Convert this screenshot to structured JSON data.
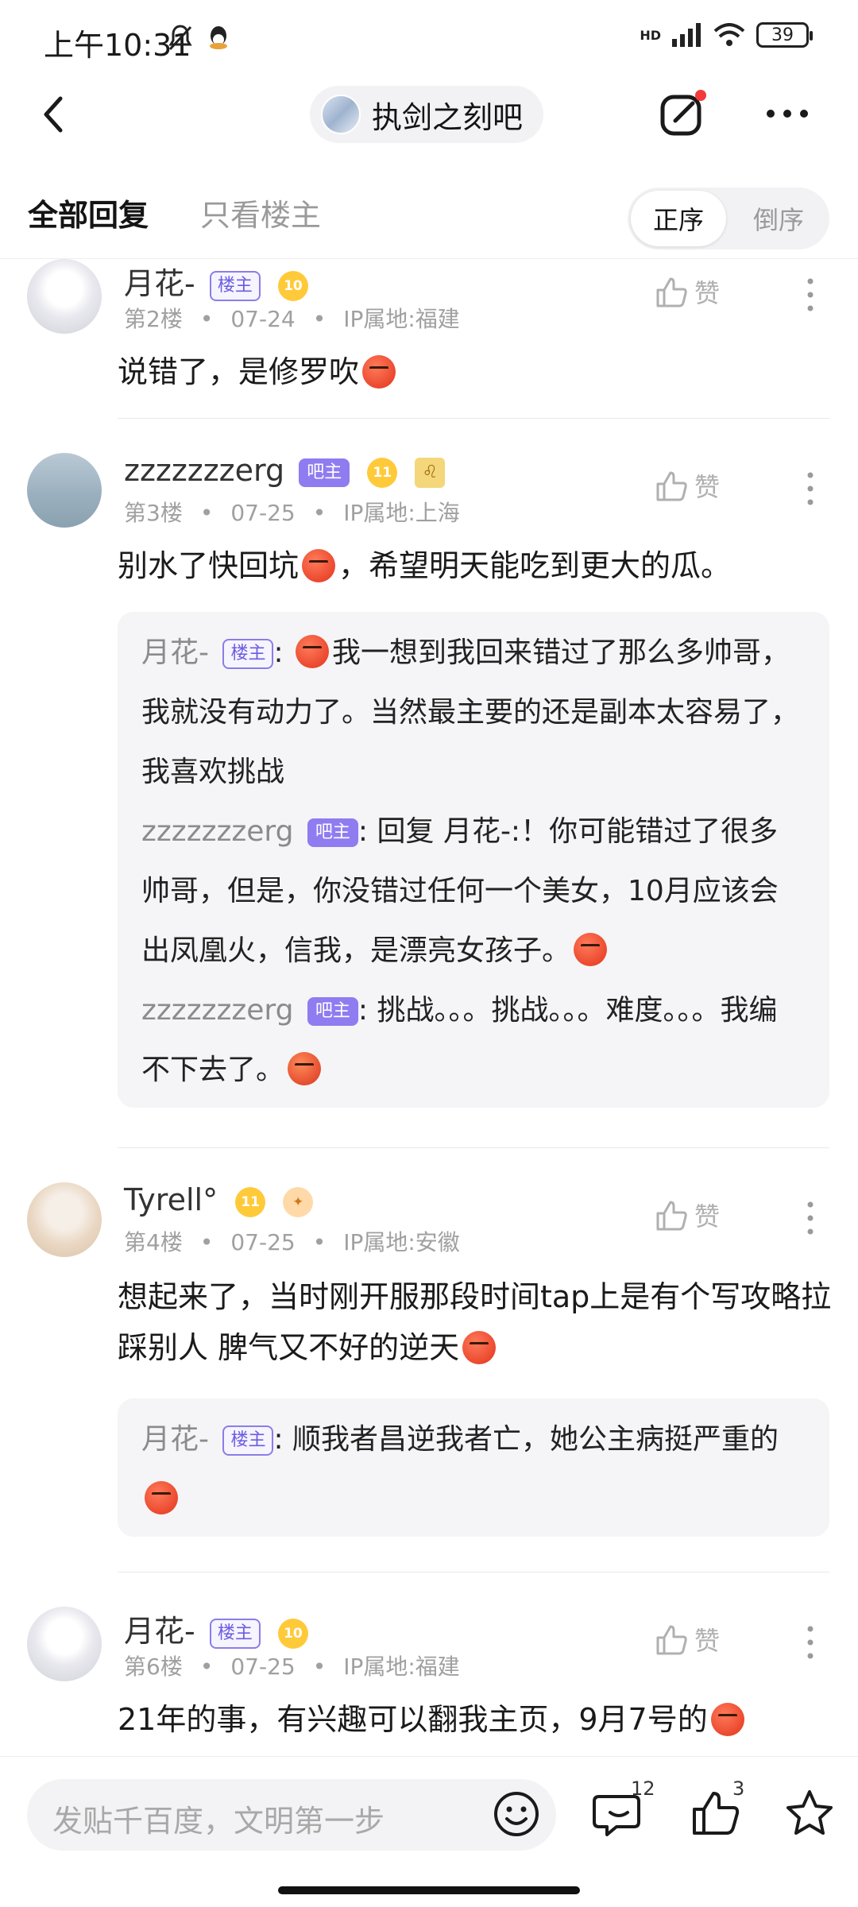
{
  "status_bar": {
    "time": "上午10:31",
    "network": "HD",
    "battery": "39"
  },
  "header": {
    "back_icon": "chevron-left-icon",
    "forum_name": "执剑之刻吧",
    "edit_icon": "edit-icon",
    "more_icon": "more-icon"
  },
  "tabs": {
    "all": "全部回复",
    "host_only": "只看楼主",
    "order_asc": "正序",
    "order_desc": "倒序"
  },
  "floors": [
    {
      "user": "月花-",
      "tag": "楼主",
      "level": "10",
      "floor": "第2楼",
      "date": "07-24",
      "ip": "IP属地:福建",
      "like": "赞",
      "text": "说错了，是修罗吹"
    },
    {
      "user": "zzzzzzzerg",
      "tag": "吧主",
      "level": "11",
      "floor": "第3楼",
      "date": "07-25",
      "ip": "IP属地:上海",
      "like": "赞",
      "text": "别水了快回坑",
      "text2": "，希望明天能吃到更大的瓜。",
      "replies": [
        {
          "user": "月花-",
          "tag": "楼主",
          "text": "我一想到我回来错过了那么多帅哥，我就没有动力了。当然最主要的还是副本太容易了，我喜欢挑战"
        },
        {
          "user": "zzzzzzzerg",
          "tag": "吧主",
          "text": "回复 月花-:！你可能错过了很多帅哥，但是，你没错过任何一个美女，10月应该会出凤凰火，信我，是漂亮女孩子。"
        },
        {
          "user": "zzzzzzzerg",
          "tag": "吧主",
          "text": "挑战。。。挑战。。。难度。。。我编不下去了。"
        }
      ]
    },
    {
      "user": "Tyrell°",
      "level": "11",
      "floor": "第4楼",
      "date": "07-25",
      "ip": "IP属地:安徽",
      "like": "赞",
      "text": "想起来了，当时刚开服那段时间tap上是有个写攻略拉踩别人 脾气又不好的逆天",
      "replies": [
        {
          "user": "月花-",
          "tag": "楼主",
          "text": "顺我者昌逆我者亡，她公主病挺严重的"
        }
      ]
    },
    {
      "user": "月花-",
      "tag": "楼主",
      "level": "10",
      "floor": "第6楼",
      "date": "07-25",
      "ip": "IP属地:福建",
      "like": "赞",
      "text": "21年的事，有兴趣可以翻我主页，9月7号的"
    }
  ],
  "bottom_bar": {
    "input_placeholder": "发贴千百度，文明第一步",
    "comment_count": "12",
    "like_count": "3"
  }
}
